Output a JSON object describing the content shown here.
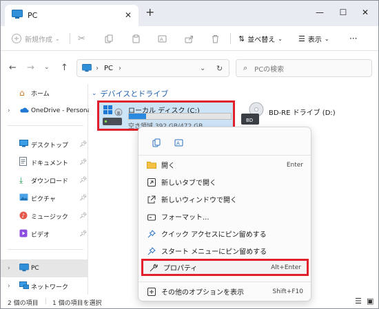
{
  "window": {
    "tab_title": "PC",
    "new_tab": "+",
    "tab_close": "✕",
    "minimize": "—",
    "maximize": "☐",
    "close": "✕"
  },
  "toolbar": {
    "new_label": "新規作成",
    "sort_label": "並べ替え",
    "view_label": "表示",
    "more_label": "···"
  },
  "address": {
    "path": [
      "PC"
    ],
    "search_placeholder": "PCの検索"
  },
  "sidebar": {
    "items": [
      {
        "label": "ホーム",
        "icon": "home-icon"
      },
      {
        "label": "OneDrive - Persona",
        "icon": "onedrive-icon"
      },
      {
        "label": "デスクトップ",
        "icon": "desktop-icon"
      },
      {
        "label": "ドキュメント",
        "icon": "documents-icon"
      },
      {
        "label": "ダウンロード",
        "icon": "download-icon"
      },
      {
        "label": "ピクチャ",
        "icon": "pictures-icon"
      },
      {
        "label": "ミュージック",
        "icon": "music-icon"
      },
      {
        "label": "ビデオ",
        "icon": "video-icon"
      },
      {
        "label": "PC",
        "icon": "pc-icon"
      },
      {
        "label": "ネットワーク",
        "icon": "network-icon"
      }
    ]
  },
  "content": {
    "group_header": "デバイスとドライブ",
    "drives": [
      {
        "name": "ローカル ディスク (C:)",
        "space": "空き領域 392 GB/472 GB",
        "used_fraction": 0.17
      },
      {
        "name": "BD-RE ドライブ (D:)",
        "badge": "BD"
      }
    ]
  },
  "context_menu": {
    "items": [
      {
        "label": "開く",
        "shortcut": "Enter",
        "icon": "folder-open-icon"
      },
      {
        "label": "新しいタブで開く",
        "shortcut": "",
        "icon": "new-tab-icon"
      },
      {
        "label": "新しいウィンドウで開く",
        "shortcut": "",
        "icon": "new-window-icon"
      },
      {
        "label": "フォーマット...",
        "shortcut": "",
        "icon": "format-icon"
      },
      {
        "label": "クイック アクセスにピン留めする",
        "shortcut": "",
        "icon": "pin-icon"
      },
      {
        "label": "スタート メニューにピン留めする",
        "shortcut": "",
        "icon": "pin-start-icon"
      },
      {
        "label": "プロパティ",
        "shortcut": "Alt+Enter",
        "icon": "wrench-icon"
      },
      {
        "label": "その他のオプションを表示",
        "shortcut": "Shift+F10",
        "icon": "more-options-icon"
      }
    ]
  },
  "status": {
    "count": "2 個の項目",
    "selected": "1 個の項目を選択"
  },
  "colors": {
    "accent": "#1f5fa8",
    "highlight_box": "#e0202a",
    "selection": "#cde4f7",
    "drive_bar": "#2a8ae0"
  }
}
